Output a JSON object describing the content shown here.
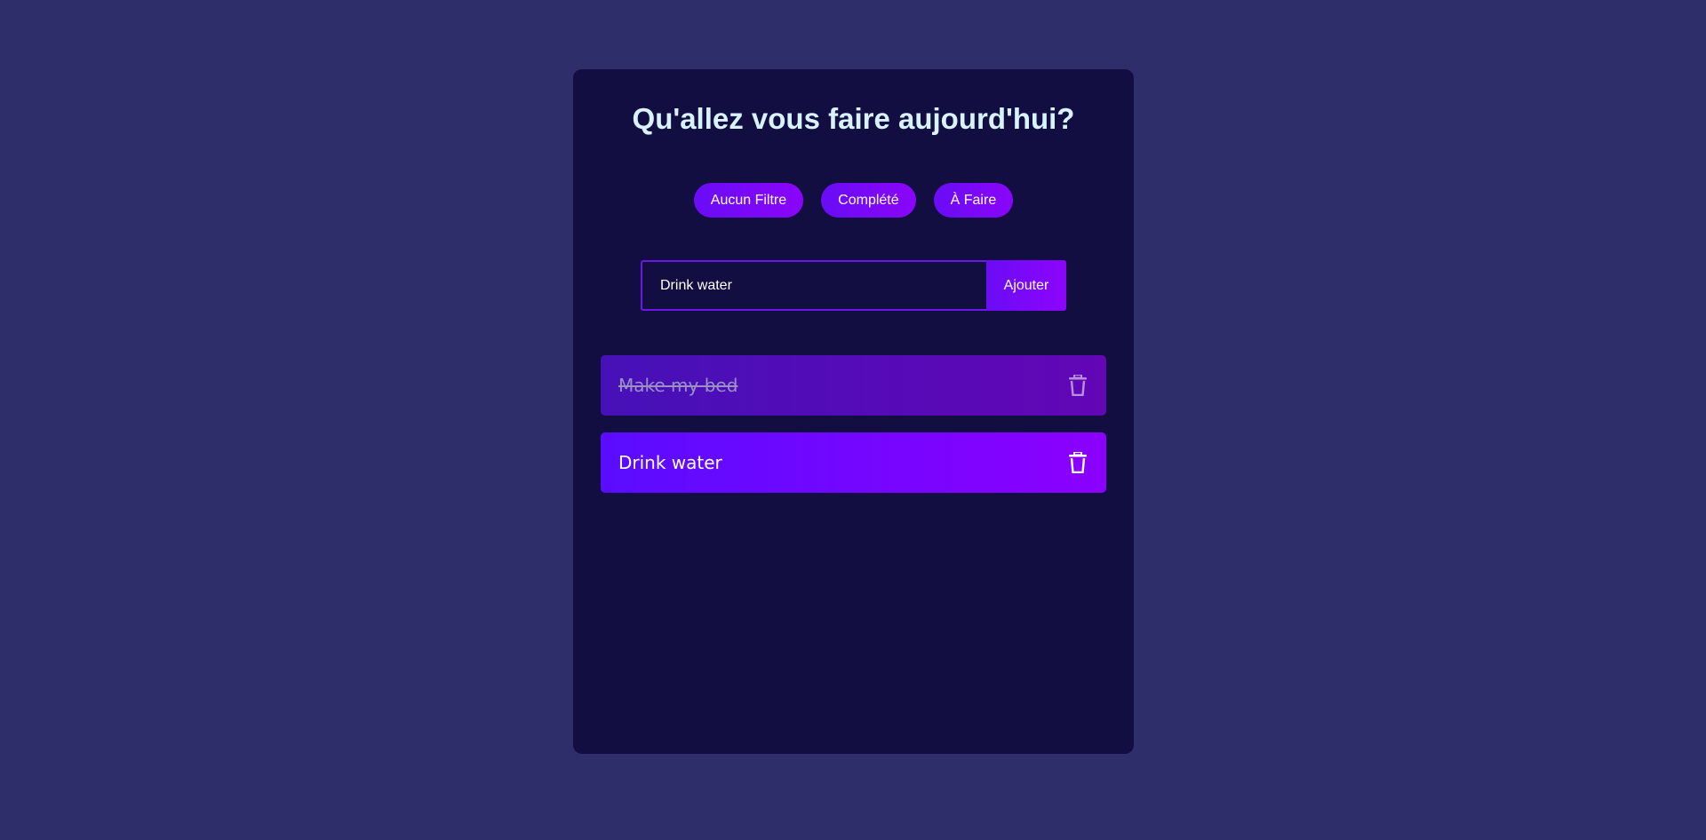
{
  "title": "Qu'allez vous faire aujourd'hui?",
  "filters": [
    {
      "label": "Aucun Filtre"
    },
    {
      "label": "Complété"
    },
    {
      "label": "À Faire"
    }
  ],
  "add_form": {
    "input_value": "Drink water",
    "button_label": "Ajouter"
  },
  "todos": [
    {
      "text": "Make my bed",
      "completed": true,
      "icon": "trash-icon"
    },
    {
      "text": "Drink water",
      "completed": false,
      "icon": "trash-icon"
    }
  ],
  "colors": {
    "background": "#2e2f6a",
    "card": "#120e42",
    "title": "#d8f2ff",
    "accent_start": "#5a0cff",
    "accent_end": "#8c00ff"
  }
}
